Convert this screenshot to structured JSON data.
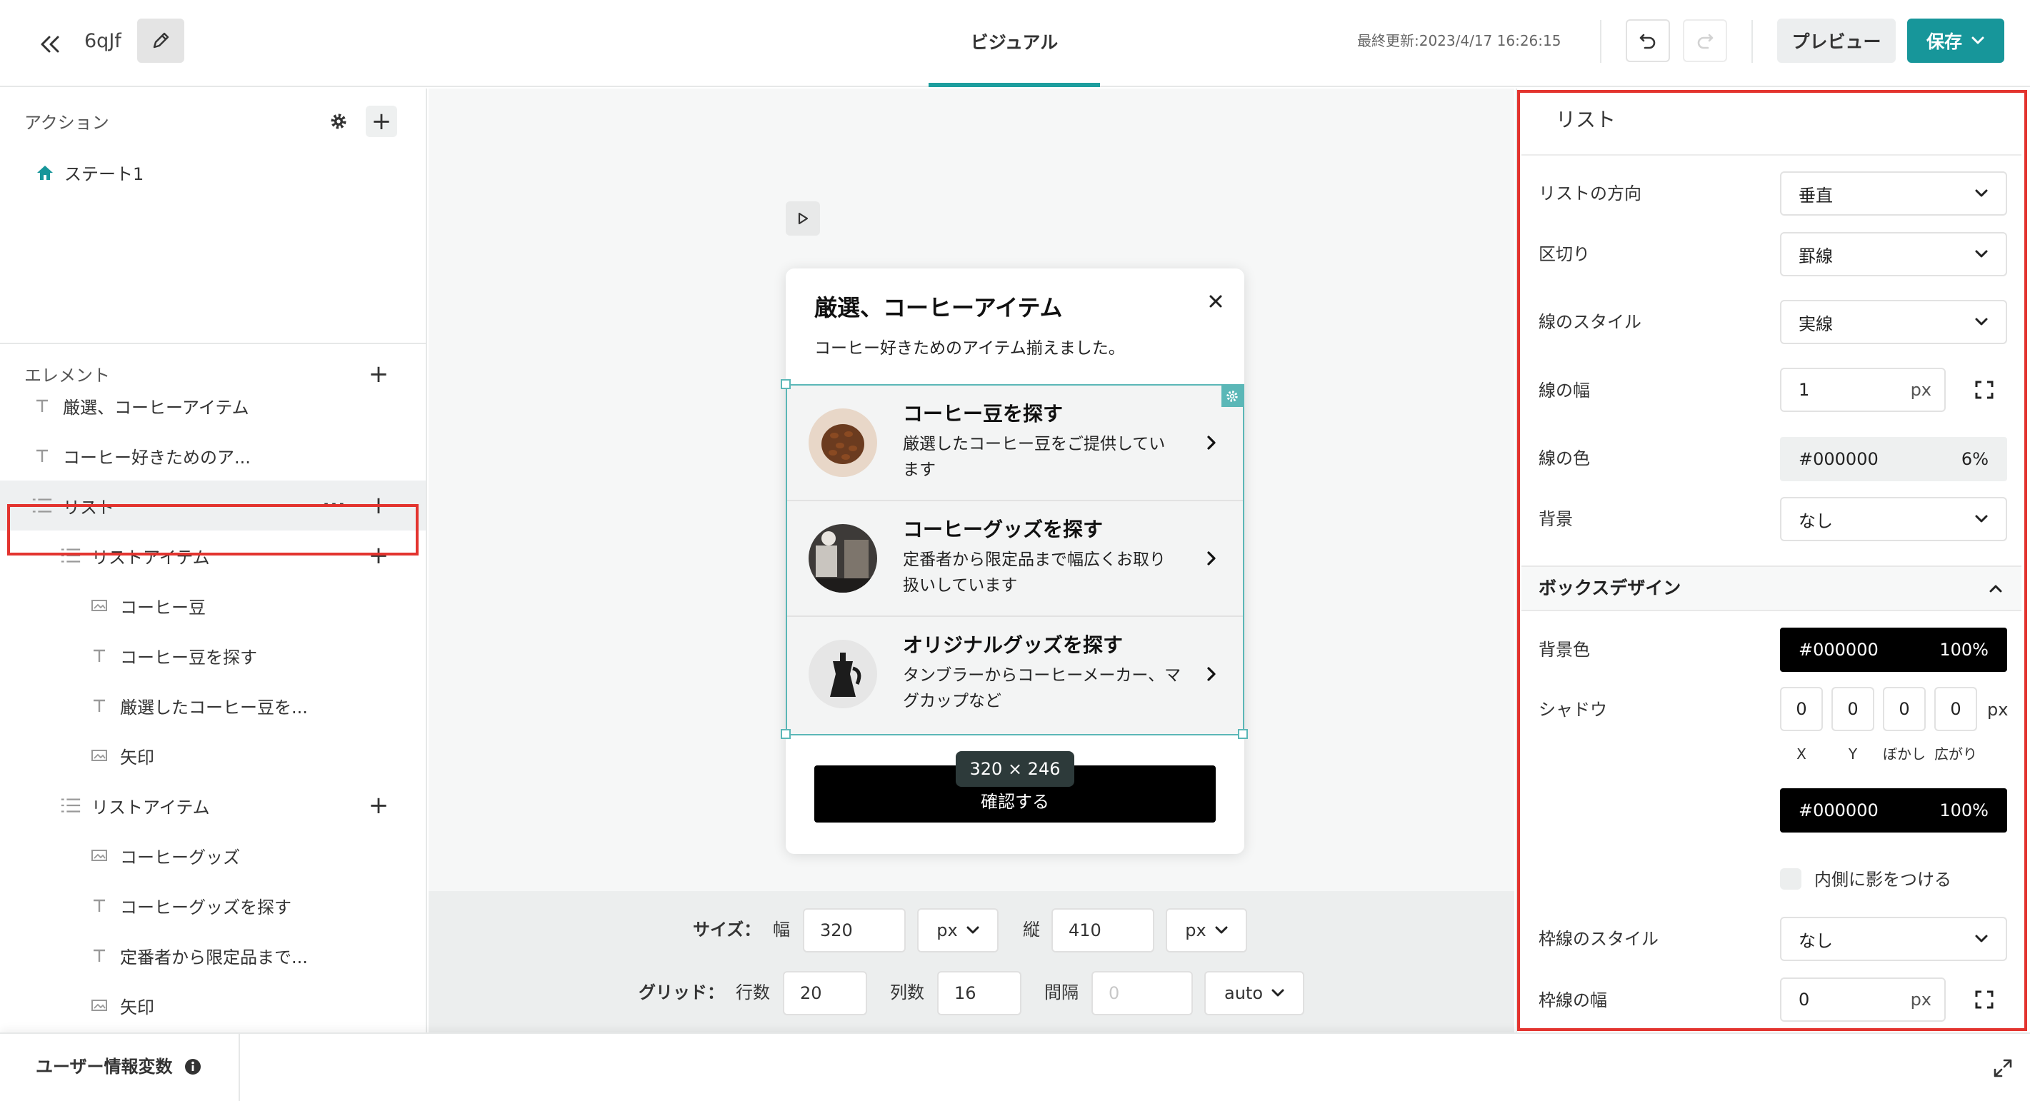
{
  "topbar": {
    "project_name": "6qJf",
    "tab_visual": "ビジュアル",
    "last_updated": "最終更新:2023/4/17 16:26:15",
    "preview_label": "プレビュー",
    "save_label": "保存"
  },
  "left": {
    "actions_title": "アクション",
    "state_label": "ステート1",
    "elements_title": "エレメント",
    "tree": [
      {
        "label": "厳選、コーヒーアイテム",
        "icon": "text-icon"
      },
      {
        "label": "コーヒー好きためのア...",
        "icon": "text-icon"
      },
      {
        "label": "リスト",
        "icon": "list-icon"
      },
      {
        "label": "リストアイテム",
        "icon": "list-icon"
      },
      {
        "label": "コーヒー豆",
        "icon": "image-icon"
      },
      {
        "label": "コーヒー豆を探す",
        "icon": "text-icon"
      },
      {
        "label": "厳選したコーヒー豆を...",
        "icon": "text-icon"
      },
      {
        "label": "矢印",
        "icon": "image-icon"
      },
      {
        "label": "リストアイテム",
        "icon": "list-icon"
      },
      {
        "label": "コーヒーグッズ",
        "icon": "image-icon"
      },
      {
        "label": "コーヒーグッズを探す",
        "icon": "text-icon"
      },
      {
        "label": "定番者から限定品まで...",
        "icon": "text-icon"
      },
      {
        "label": "矢印",
        "icon": "image-icon"
      }
    ]
  },
  "modal": {
    "title": "厳選、コーヒーアイテム",
    "subtitle": "コーヒー好きためのアイテム揃えました。",
    "items": [
      {
        "title": "コーヒー豆を探す",
        "desc": "厳選したコーヒー豆をご提供しています"
      },
      {
        "title": "コーヒーグッズを探す",
        "desc": "定番者から限定品まで幅広くお取り扱いしています"
      },
      {
        "title": "オリジナルグッズを探す",
        "desc": "タンブラーからコーヒーメーカー、マグカップなど"
      }
    ],
    "confirm_label": "確認する",
    "dimension_badge": "320 × 246"
  },
  "controls": {
    "size_label": "サイズ：",
    "width_label": "幅",
    "width_value": "320",
    "width_unit": "px",
    "height_label": "縦",
    "height_value": "410",
    "height_unit": "px",
    "grid_label": "グリッド：",
    "rows_label": "行数",
    "rows_value": "20",
    "cols_label": "列数",
    "cols_value": "16",
    "gap_label": "間隔",
    "gap_placeholder": "0",
    "gap_unit": "auto"
  },
  "footer": {
    "label": "ユーザー情報変数"
  },
  "right": {
    "title": "リスト",
    "direction_label": "リストの方向",
    "direction_value": "垂直",
    "divider_label": "区切り",
    "divider_value": "罫線",
    "line_style_label": "線のスタイル",
    "line_style_value": "実線",
    "line_width_label": "線の幅",
    "line_width_value": "1",
    "line_width_unit": "px",
    "line_color_label": "線の色",
    "line_color_value": "#000000",
    "line_color_opacity": "6%",
    "bg_label": "背景",
    "bg_value": "なし",
    "box_title": "ボックスデザイン",
    "bg_color_label": "背景色",
    "bg_color_value": "#000000",
    "bg_color_opacity": "100%",
    "shadow_label": "シャドウ",
    "shadow": [
      {
        "value": "0",
        "label": "X"
      },
      {
        "value": "0",
        "label": "Y"
      },
      {
        "value": "0",
        "label": "ぼかし"
      },
      {
        "value": "0",
        "label": "広がり"
      }
    ],
    "shadow_unit": "px",
    "shadow_color_value": "#000000",
    "shadow_color_opacity": "100%",
    "inset_label": "内側に影をつける",
    "border_style_label": "枠線のスタイル",
    "border_style_value": "なし",
    "border_width_label": "枠線の幅",
    "border_width_value": "0",
    "border_width_unit": "px"
  },
  "colors": {
    "accent": "#17969a",
    "highlight": "#e3342f",
    "selection": "#5bb7b7"
  }
}
